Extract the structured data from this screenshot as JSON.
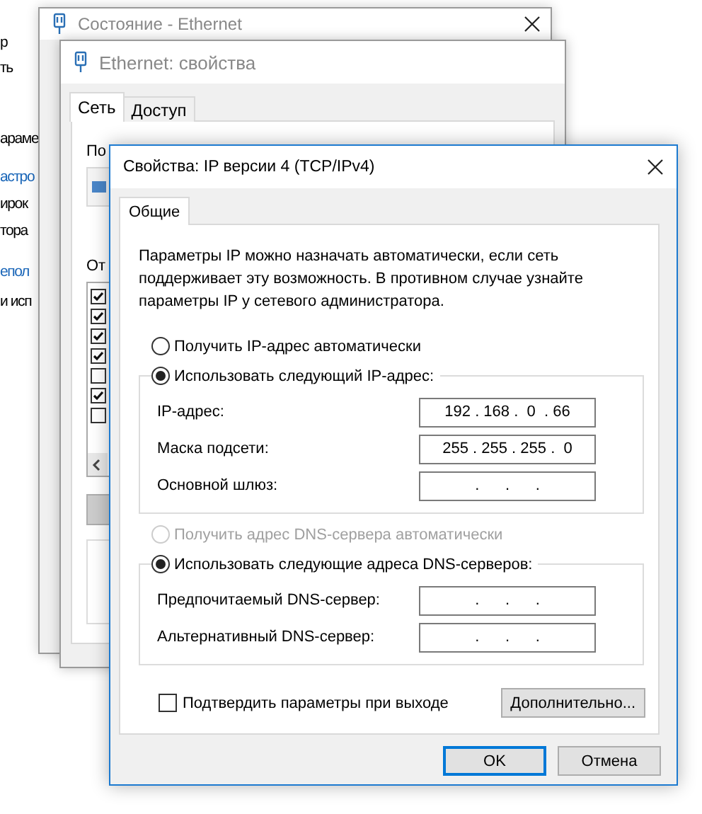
{
  "background_window": {
    "texts": [
      {
        "text": "р",
        "kind": "text"
      },
      {
        "text": "ть",
        "kind": "text"
      },
      {
        "text": "араме",
        "kind": "text"
      },
      {
        "text": "астро",
        "kind": "link"
      },
      {
        "text": "ирок",
        "kind": "text"
      },
      {
        "text": "тора",
        "kind": "text"
      },
      {
        "text": "епол",
        "kind": "link"
      },
      {
        "text": "и исп",
        "kind": "text"
      }
    ]
  },
  "status_window": {
    "title": "Состояние - Ethernet"
  },
  "properties_window": {
    "title": "Ethernet: свойства",
    "tabs": [
      {
        "label": "Сеть",
        "selected": true
      },
      {
        "label": "Доступ",
        "selected": false
      }
    ],
    "connect_label": "По",
    "components_label": "От",
    "components": [
      {
        "checked": true
      },
      {
        "checked": true
      },
      {
        "checked": true
      },
      {
        "checked": true
      },
      {
        "checked": false
      },
      {
        "checked": true
      },
      {
        "checked": false
      }
    ]
  },
  "ipv4_dialog": {
    "title": "Свойства: IP версии 4 (TCP/IPv4)",
    "tabs": [
      {
        "label": "Общие",
        "selected": true
      }
    ],
    "description": "Параметры IP можно назначать автоматически, если сеть поддерживает эту возможность. В противном случае узнайте параметры IP у сетевого администратора.",
    "ip_auto": {
      "label": "Получить IP-адрес автоматически",
      "selected": false,
      "disabled": false
    },
    "ip_manual": {
      "label": "Использовать следующий IP-адрес:",
      "selected": true,
      "disabled": false
    },
    "ip_fields": [
      {
        "label": "IP-адрес:",
        "value": "192 . 168 .  0  . 66"
      },
      {
        "label": "Маска подсети:",
        "value": "255 . 255 . 255 .  0"
      },
      {
        "label": "Основной шлюз:",
        "value": ".      .      ."
      }
    ],
    "dns_auto": {
      "label": "Получить адрес DNS-сервера автоматически",
      "selected": false,
      "disabled": true
    },
    "dns_manual": {
      "label": "Использовать следующие адреса DNS-серверов:",
      "selected": true,
      "disabled": false
    },
    "dns_fields": [
      {
        "label": "Предпочитаемый DNS-сервер:",
        "value": ".      .      ."
      },
      {
        "label": "Альтернативный DNS-сервер:",
        "value": ".      .      ."
      }
    ],
    "validate": {
      "label": "Подтвердить параметры при выходе",
      "checked": false
    },
    "advanced_button": "Дополнительно...",
    "buttons": [
      {
        "label": "OK",
        "default": true
      },
      {
        "label": "Отмена",
        "default": false
      }
    ]
  }
}
